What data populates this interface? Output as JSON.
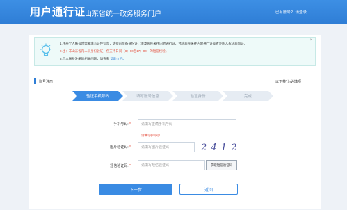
{
  "header": {
    "brand": "用户通行证",
    "subtitle": "山东省统一政务服务门户",
    "have_account": "已有账号?",
    "login_link": "请登录"
  },
  "notice": {
    "line1": "1.注册个人账号时需要填写证件信息，请提前准备身份证、港澳居民来往内地通行证、台湾居民来往内地通行证或者外国人永久居留证。",
    "line2": "2.注：非山东省内人员身份验证，仅支持日间（8：00至17：00）的短信校验。",
    "line3_prefix": "3.个人账号注册的相关问题，请查看",
    "line3_link": "帮助文档。"
  },
  "section": {
    "title": "账号注册",
    "right_link": "以下带*为必填项"
  },
  "steps": [
    "验证手机号码",
    "填写账号信息",
    "验证身份",
    "完成"
  ],
  "form": {
    "phone_label": "手机号码:",
    "phone_placeholder": "请填写正确手机号码",
    "phone_error": "请填写手机号!",
    "captcha_label": "图片验证码:",
    "captcha_placeholder": "请填写图片验证码",
    "captcha_text": "2 4 1 2",
    "sms_label": "短信验证码:",
    "sms_placeholder": "请填写短信验证码",
    "sms_button": "获取短信验证码"
  },
  "buttons": {
    "next": "下一步",
    "back": "返回"
  },
  "colors": {
    "primary": "#3a8be3",
    "header": "#2f7ed6",
    "error": "#e44d3c",
    "notice_bg": "#eefaf9"
  }
}
